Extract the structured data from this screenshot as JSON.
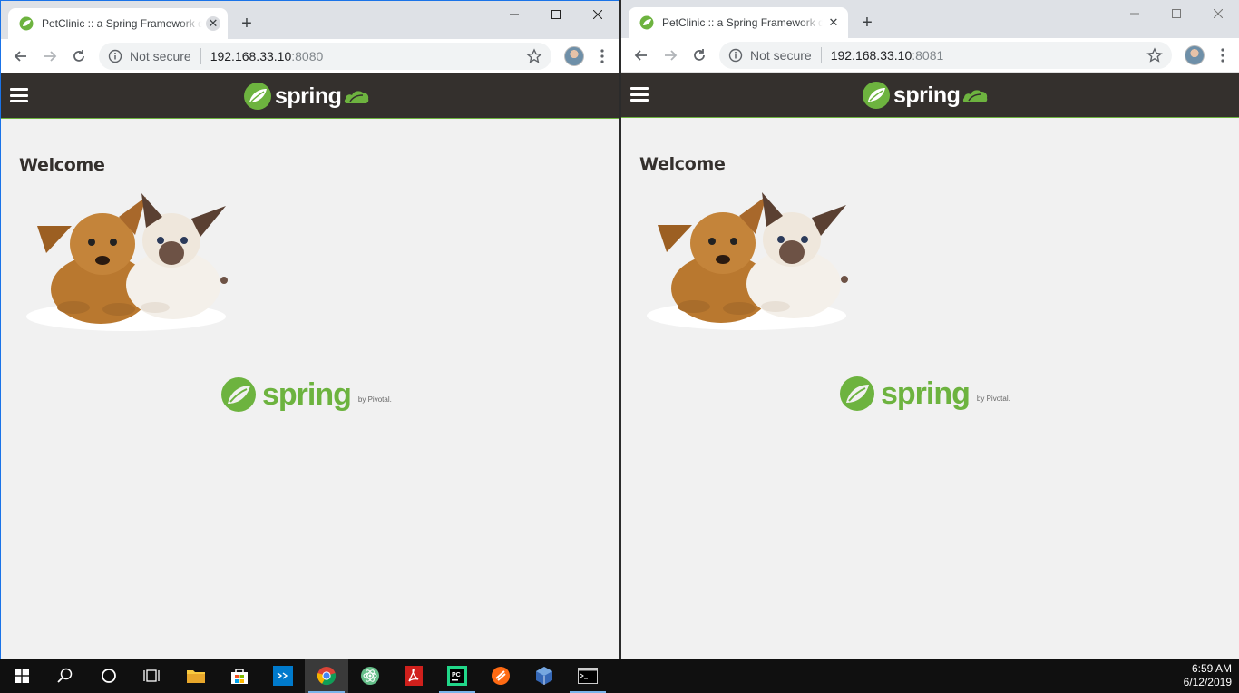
{
  "browser_left": {
    "tab_title": "PetClinic :: a Spring Framework demonstration",
    "not_secure": "Not secure",
    "url_host": "192.168.33.10",
    "url_port": ":8080"
  },
  "browser_right": {
    "tab_title": "PetClinic :: a Spring Framework demonstration",
    "not_secure": "Not secure",
    "url_host": "192.168.33.10",
    "url_port": ":8081"
  },
  "app": {
    "logo_text": "spring",
    "welcome": "Welcome",
    "footer_logo_text": "spring",
    "footer_by": "by Pivotal."
  },
  "colors": {
    "spring_green": "#6db33f",
    "navbar_bg": "#34302d",
    "page_bg": "#f1f1f1"
  },
  "taskbar": {
    "items": [
      "windows-start-icon",
      "search-icon",
      "cortana-icon",
      "task-view-icon",
      "file-explorer-icon",
      "store-icon",
      "vscode-icon",
      "chrome-icon",
      "atom-icon",
      "acrobat-icon",
      "pycharm-icon",
      "sublime-icon",
      "virtualbox-icon",
      "terminal-icon"
    ],
    "time": "6:59 AM",
    "date": "6/12/2019"
  }
}
